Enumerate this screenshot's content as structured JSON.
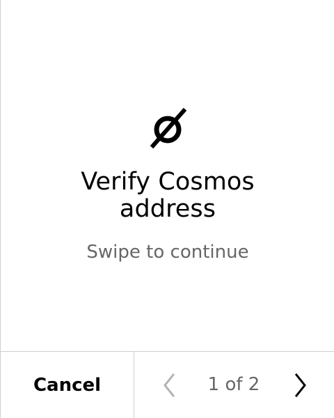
{
  "screen": {
    "icon": "empty-set-icon",
    "title": "Verify Cosmos address",
    "subtitle": "Swipe to continue"
  },
  "footer": {
    "cancel_label": "Cancel",
    "pager": {
      "text": "1 of 2",
      "current": 1,
      "total": 2,
      "prev_icon": "chevron-left-icon",
      "next_icon": "chevron-right-icon",
      "prev_enabled": false,
      "next_enabled": true
    }
  },
  "colors": {
    "background": "#ffffff",
    "primary_text": "#000000",
    "secondary_text": "#666666",
    "divider": "#cfcfcf",
    "disabled_icon": "#b3b3b3"
  }
}
